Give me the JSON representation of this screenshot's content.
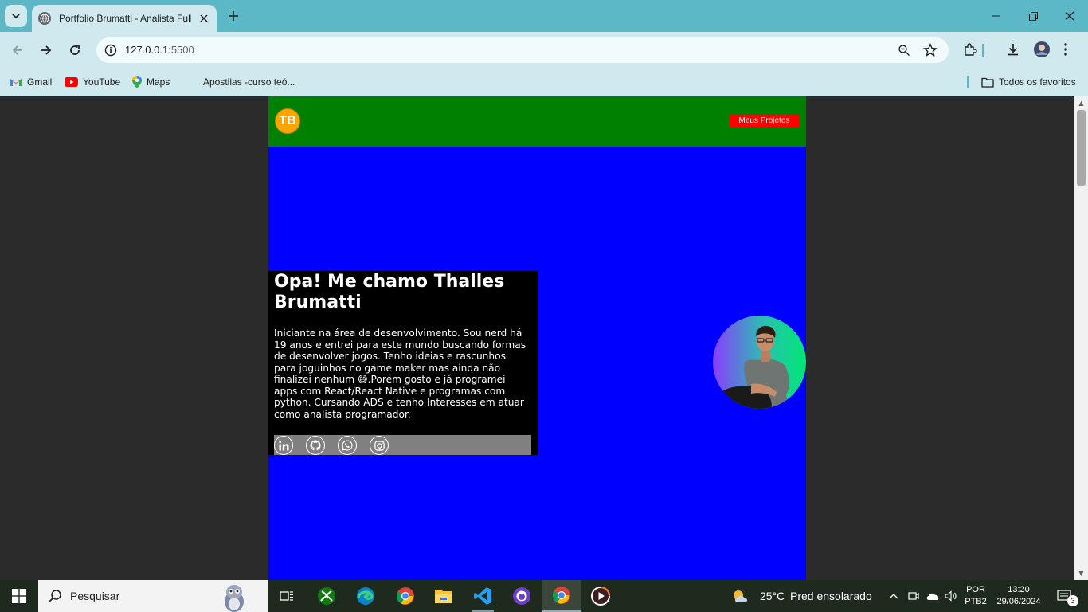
{
  "browser": {
    "tab_title": "Portfolio Brumatti - Analista Fullstack",
    "url_host": "127.0.0.1",
    "url_port": ":5500",
    "bookmarks": [
      {
        "label": "Gmail"
      },
      {
        "label": "YouTube"
      },
      {
        "label": "Maps"
      },
      {
        "label": "Apostilas -curso teó..."
      }
    ],
    "all_bookmarks_label": "Todos os favoritos"
  },
  "site": {
    "logo_text": "TB",
    "projects_button": "Meus Projetos",
    "heading": "Opa! Me chamo Thalles Brumatti",
    "bio": "Iniciante na área de desenvolvimento. Sou nerd há 19 anos e entrei para este mundo buscando formas de desenvolver jogos. Tenho ideias e rascunhos para joguinhos no game maker mas ainda não finalizei nenhum 😅.Porém gosto e já programei apps com React/React Native e programas com python. Cursando ADS e tenho Interesses em atuar como analista programador.",
    "social_icons": [
      "linkedin-icon",
      "github-icon",
      "whatsapp-icon",
      "instagram-icon"
    ],
    "colors": {
      "header": "#008000",
      "body": "#0000ff",
      "card": "#000000",
      "button": "#ff0000",
      "logo": "#ffa500",
      "social_bar": "#808080"
    }
  },
  "taskbar": {
    "search_placeholder": "Pesquisar",
    "weather_temp": "25°C",
    "weather_desc": "Pred ensolarado",
    "lang_top": "POR",
    "lang_bottom": "PTB2",
    "time": "13:20",
    "date": "29/06/2024",
    "notifications": "3"
  }
}
